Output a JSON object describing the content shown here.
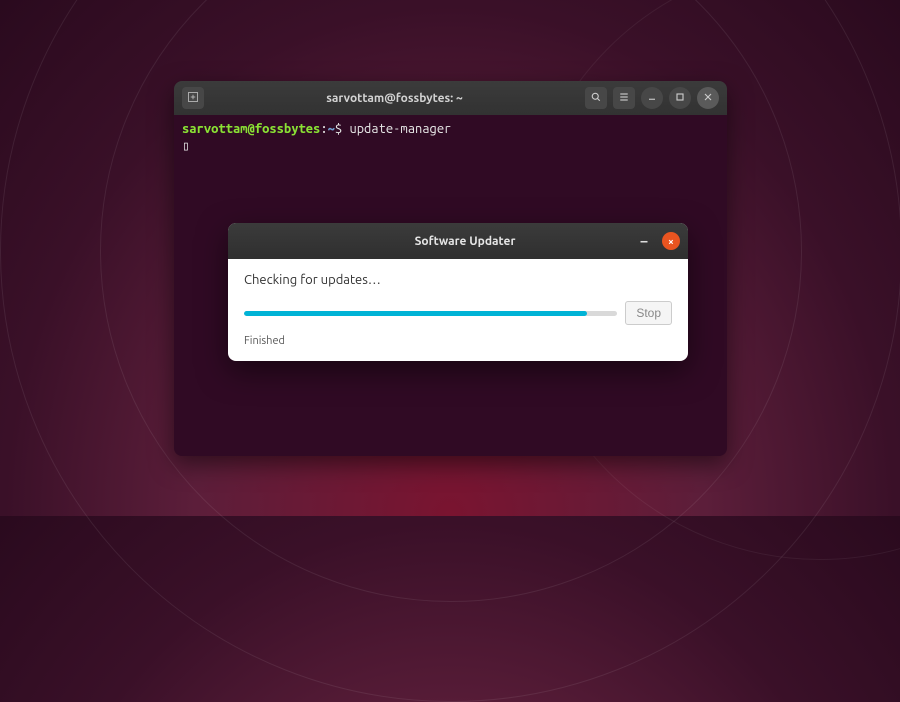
{
  "desktop": {
    "bg_accent": "#5c1e3a"
  },
  "terminal": {
    "title": "sarvottam@fossbytes: ~",
    "prompt": {
      "user": "sarvottam",
      "at": "@",
      "host": "fossbytes",
      "colon": ":",
      "path": "~",
      "symbol": "$"
    },
    "command": "update-manager",
    "cursor": "▯",
    "buttons": {
      "new_tab": "new-tab",
      "search": "search",
      "menu": "menu",
      "minimize": "minimize",
      "maximize": "maximize",
      "close": "close"
    }
  },
  "updater": {
    "title": "Software Updater",
    "checking_label": "Checking for updates…",
    "status_label": "Finished",
    "stop_label": "Stop",
    "progress_percent": 92,
    "close_icon": "×",
    "minimize_icon": "–"
  }
}
